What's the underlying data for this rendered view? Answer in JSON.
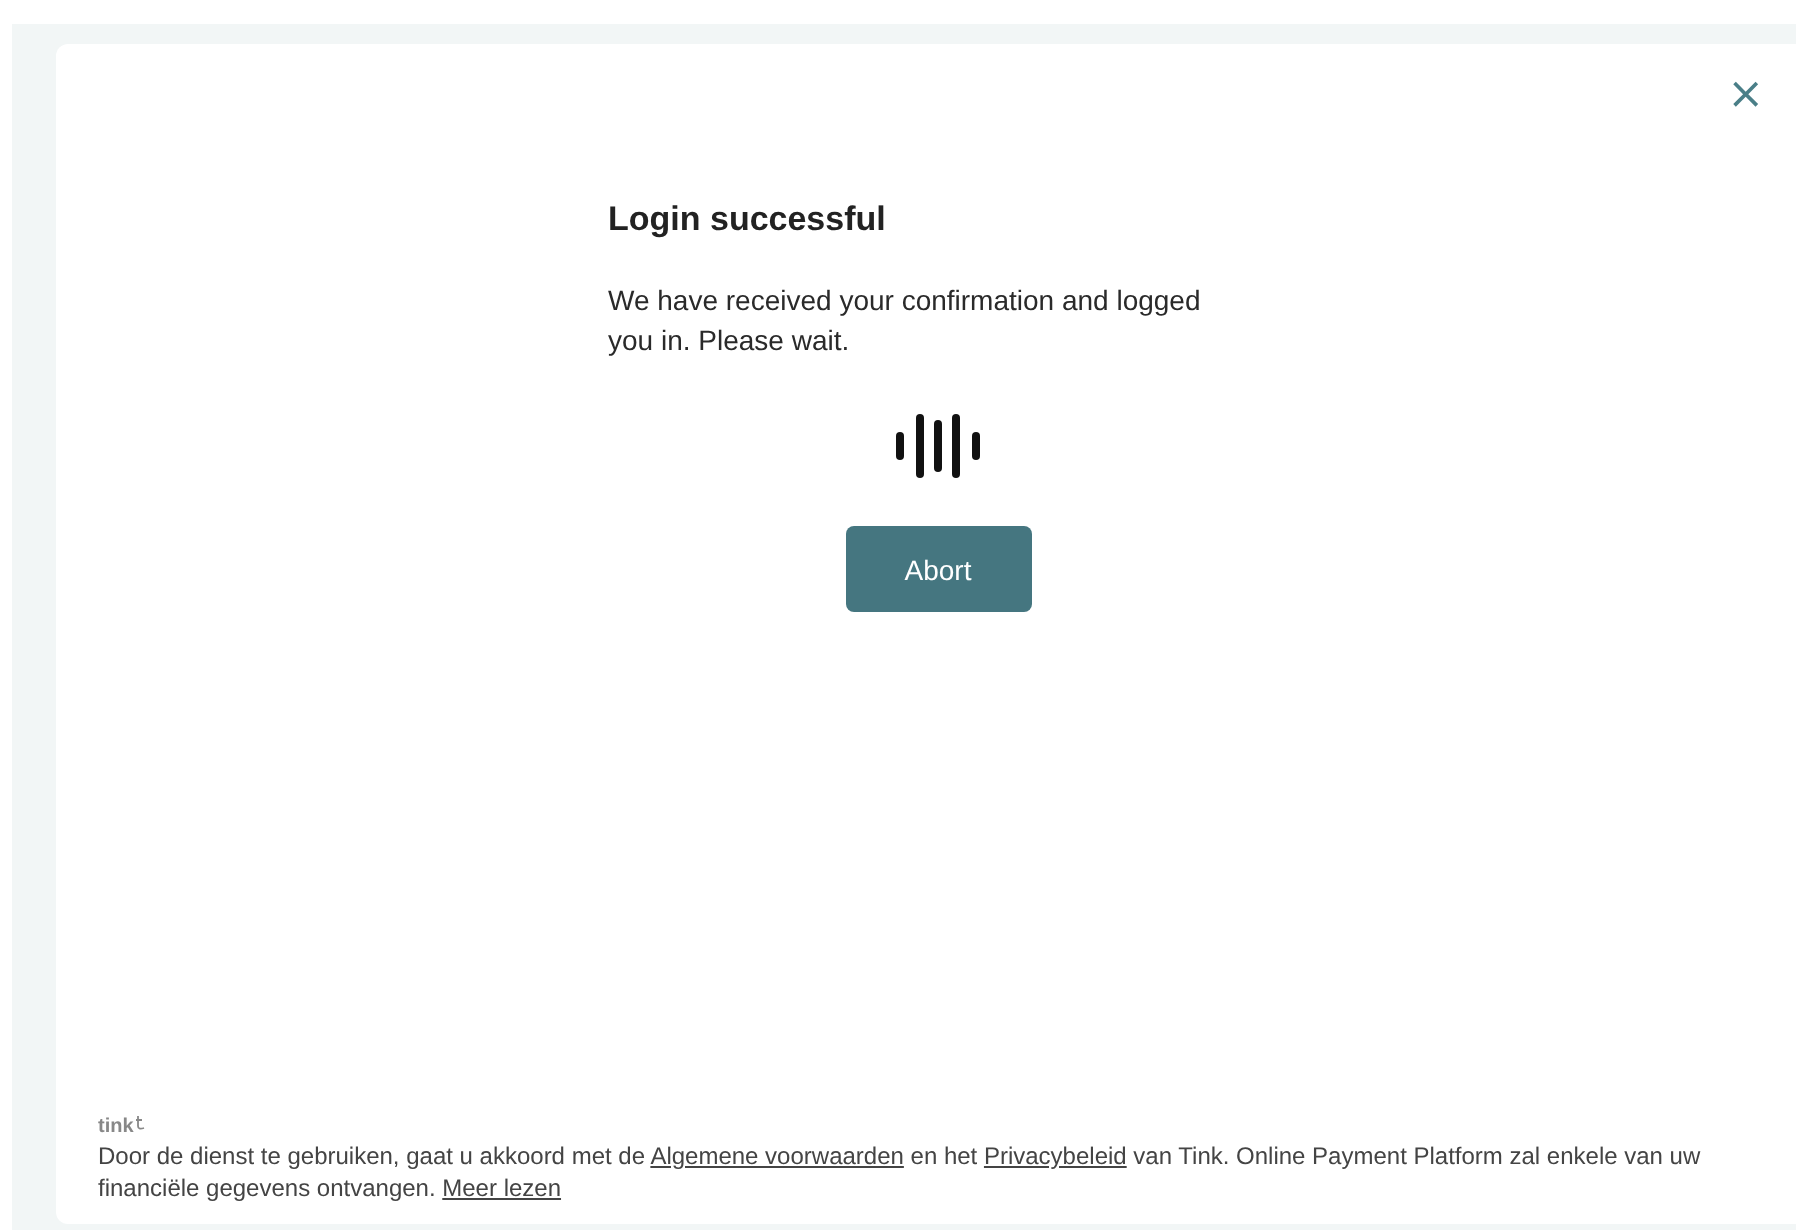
{
  "dialog": {
    "close_label": "×",
    "title": "Login successful",
    "message": "We have received your confirmation and logged you in. Please wait.",
    "button": "Abort"
  },
  "footer": {
    "brand": "tink",
    "notice": [
      {
        "kind": "text",
        "text": "Door de dienst te gebruiken, gaat u akkoord met de "
      },
      {
        "kind": "link",
        "text": "Algemene voorwaarden"
      },
      {
        "kind": "text",
        "text": " en het "
      },
      {
        "kind": "link",
        "text": "Privacybeleid"
      },
      {
        "kind": "text",
        "text": " van Tink. Online Payment Platform zal enkele van uw financiële gegevens ontvangen. "
      },
      {
        "kind": "link",
        "text": "Meer lezen"
      }
    ]
  }
}
